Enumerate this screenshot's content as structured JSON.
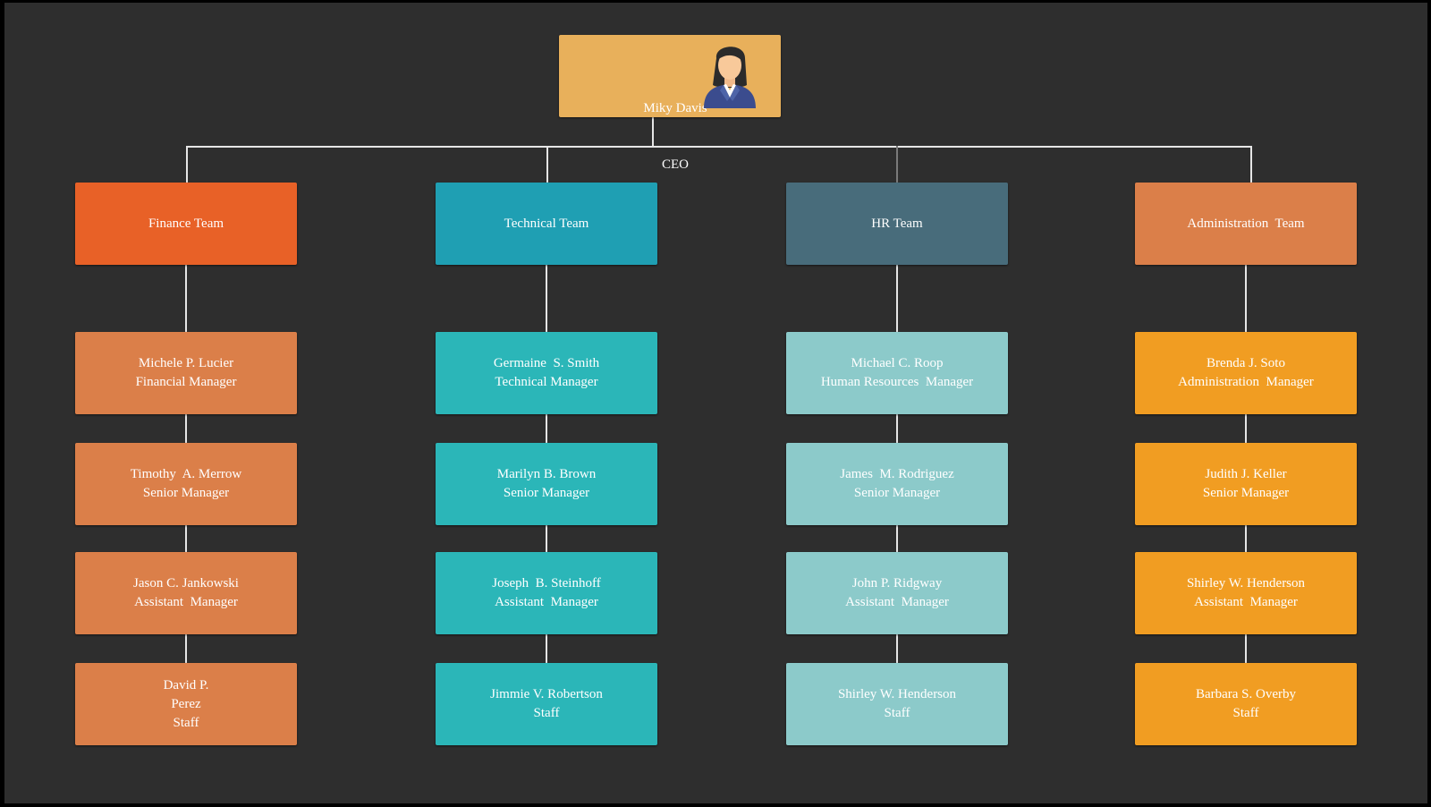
{
  "colors": {
    "background": "#2e2e2e",
    "connector": "#e6e6e6",
    "ceo": "#e8b05b",
    "finance_team": "#e86127",
    "finance_members": "#db7f49",
    "technical_team": "#1f9fb3",
    "technical_members": "#2bb6b8",
    "hr_team": "#486c7b",
    "hr_members": "#8ccaca",
    "admin_team": "#db7f49",
    "admin_members": "#f19d22"
  },
  "ceo": {
    "name": "Miky Davis",
    "title": "CEO",
    "icon": "female-executive-avatar-icon"
  },
  "teams": [
    {
      "name": "Finance Team",
      "members": [
        {
          "name": "Michele P. Lucier",
          "title": "Financial Manager"
        },
        {
          "name": "Timothy  A. Merrow",
          "title": "Senior Manager"
        },
        {
          "name": "Jason C. Jankowski",
          "title": "Assistant  Manager"
        },
        {
          "name": "David P.\nPerez",
          "title": "Staff"
        }
      ]
    },
    {
      "name": "Technical Team",
      "members": [
        {
          "name": "Germaine  S. Smith",
          "title": "Technical Manager"
        },
        {
          "name": "Marilyn B. Brown",
          "title": "Senior Manager"
        },
        {
          "name": "Joseph  B. Steinhoff",
          "title": "Assistant  Manager"
        },
        {
          "name": "Jimmie V. Robertson",
          "title": "Staff"
        }
      ]
    },
    {
      "name": "HR Team",
      "members": [
        {
          "name": "Michael C. Roop",
          "title": "Human Resources  Manager"
        },
        {
          "name": "James  M. Rodriguez",
          "title": "Senior Manager"
        },
        {
          "name": "John P. Ridgway",
          "title": "Assistant  Manager"
        },
        {
          "name": "Shirley W. Henderson",
          "title": "Staff"
        }
      ]
    },
    {
      "name": "Administration  Team",
      "members": [
        {
          "name": "Brenda J. Soto",
          "title": "Administration  Manager"
        },
        {
          "name": "Judith J. Keller",
          "title": "Senior Manager"
        },
        {
          "name": "Shirley W. Henderson",
          "title": "Assistant  Manager"
        },
        {
          "name": "Barbara S. Overby",
          "title": "Staff"
        }
      ]
    }
  ]
}
